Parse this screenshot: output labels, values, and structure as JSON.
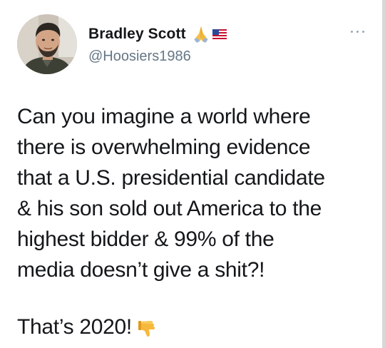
{
  "user": {
    "display_name": "Bradley Scott",
    "handle": "@Hoosiers1986",
    "name_emojis": [
      "folded-hands-icon",
      "us-flag-icon"
    ]
  },
  "menu": {
    "icon": "more-options-icon"
  },
  "tweet": {
    "lines": [
      "Can you imagine a world where",
      "there is overwhelming evidence",
      "that a U.S. presidential candidate",
      "& his son sold out America to the",
      "highest bidder & 99% of the",
      "media doesn’t give a shit?!"
    ],
    "closing": "That’s 2020!",
    "closing_emoji": "thumbs-down-icon"
  },
  "colors": {
    "text": "#14171a",
    "secondary": "#657786",
    "background": "#ffffff"
  }
}
